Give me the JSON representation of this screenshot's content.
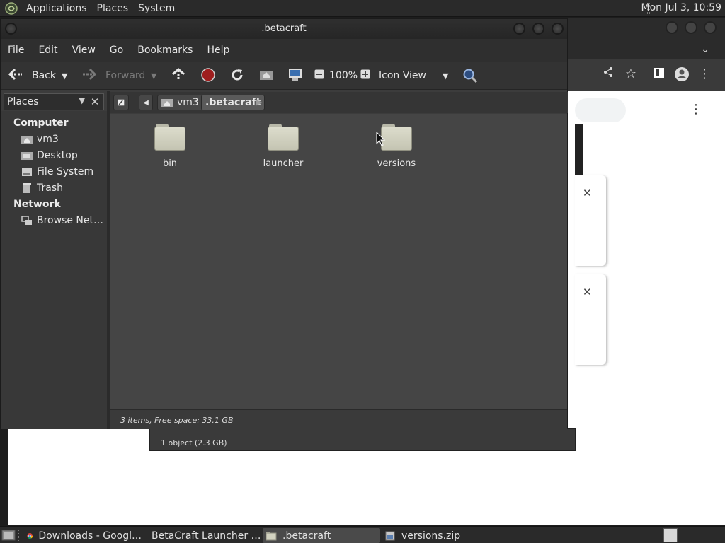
{
  "top_panel": {
    "menus": [
      "Applications",
      "Places",
      "System"
    ],
    "clock": "Mon Jul  3, 10:59"
  },
  "file_manager": {
    "title": ".betacraft",
    "menubar": [
      "File",
      "Edit",
      "View",
      "Go",
      "Bookmarks",
      "Help"
    ],
    "toolbar": {
      "back_label": "Back",
      "forward_label": "Forward",
      "zoom": "100%",
      "view_mode": "Icon View"
    },
    "side_pane": {
      "header": "Places",
      "sections": [
        {
          "title": "Computer",
          "items": [
            {
              "label": "vm3",
              "icon": "home-folder-icon"
            },
            {
              "label": "Desktop",
              "icon": "desktop-icon"
            },
            {
              "label": "File System",
              "icon": "filesystem-icon"
            },
            {
              "label": "Trash",
              "icon": "trash-icon"
            }
          ]
        },
        {
          "title": "Network",
          "items": [
            {
              "label": "Browse Net…",
              "icon": "network-icon"
            }
          ]
        }
      ]
    },
    "path": [
      "vm3",
      ".betacraft"
    ],
    "files": [
      {
        "name": "bin",
        "icon": "folder-icon"
      },
      {
        "name": "launcher",
        "icon": "folder-icon"
      },
      {
        "name": "versions",
        "icon": "folder-icon"
      }
    ],
    "status": "3 items, Free space: 33.1 GB"
  },
  "under_window": {
    "status": "1 object (2.3 GB)"
  },
  "taskbar": {
    "tasks": [
      {
        "label": "Downloads - Googl…",
        "icon": "chrome-icon"
      },
      {
        "label": "BetaCraft Launcher …",
        "icon": "java-app-icon"
      },
      {
        "label": ".betacraft",
        "icon": "folder-icon",
        "active": true
      },
      {
        "label": "versions.zip",
        "icon": "archive-icon"
      }
    ]
  },
  "colors": {
    "panel_bg": "#2a2a2a",
    "window_bg": "#3c3c3c",
    "content_bg": "#454545",
    "folder": "#d2d2c0"
  }
}
